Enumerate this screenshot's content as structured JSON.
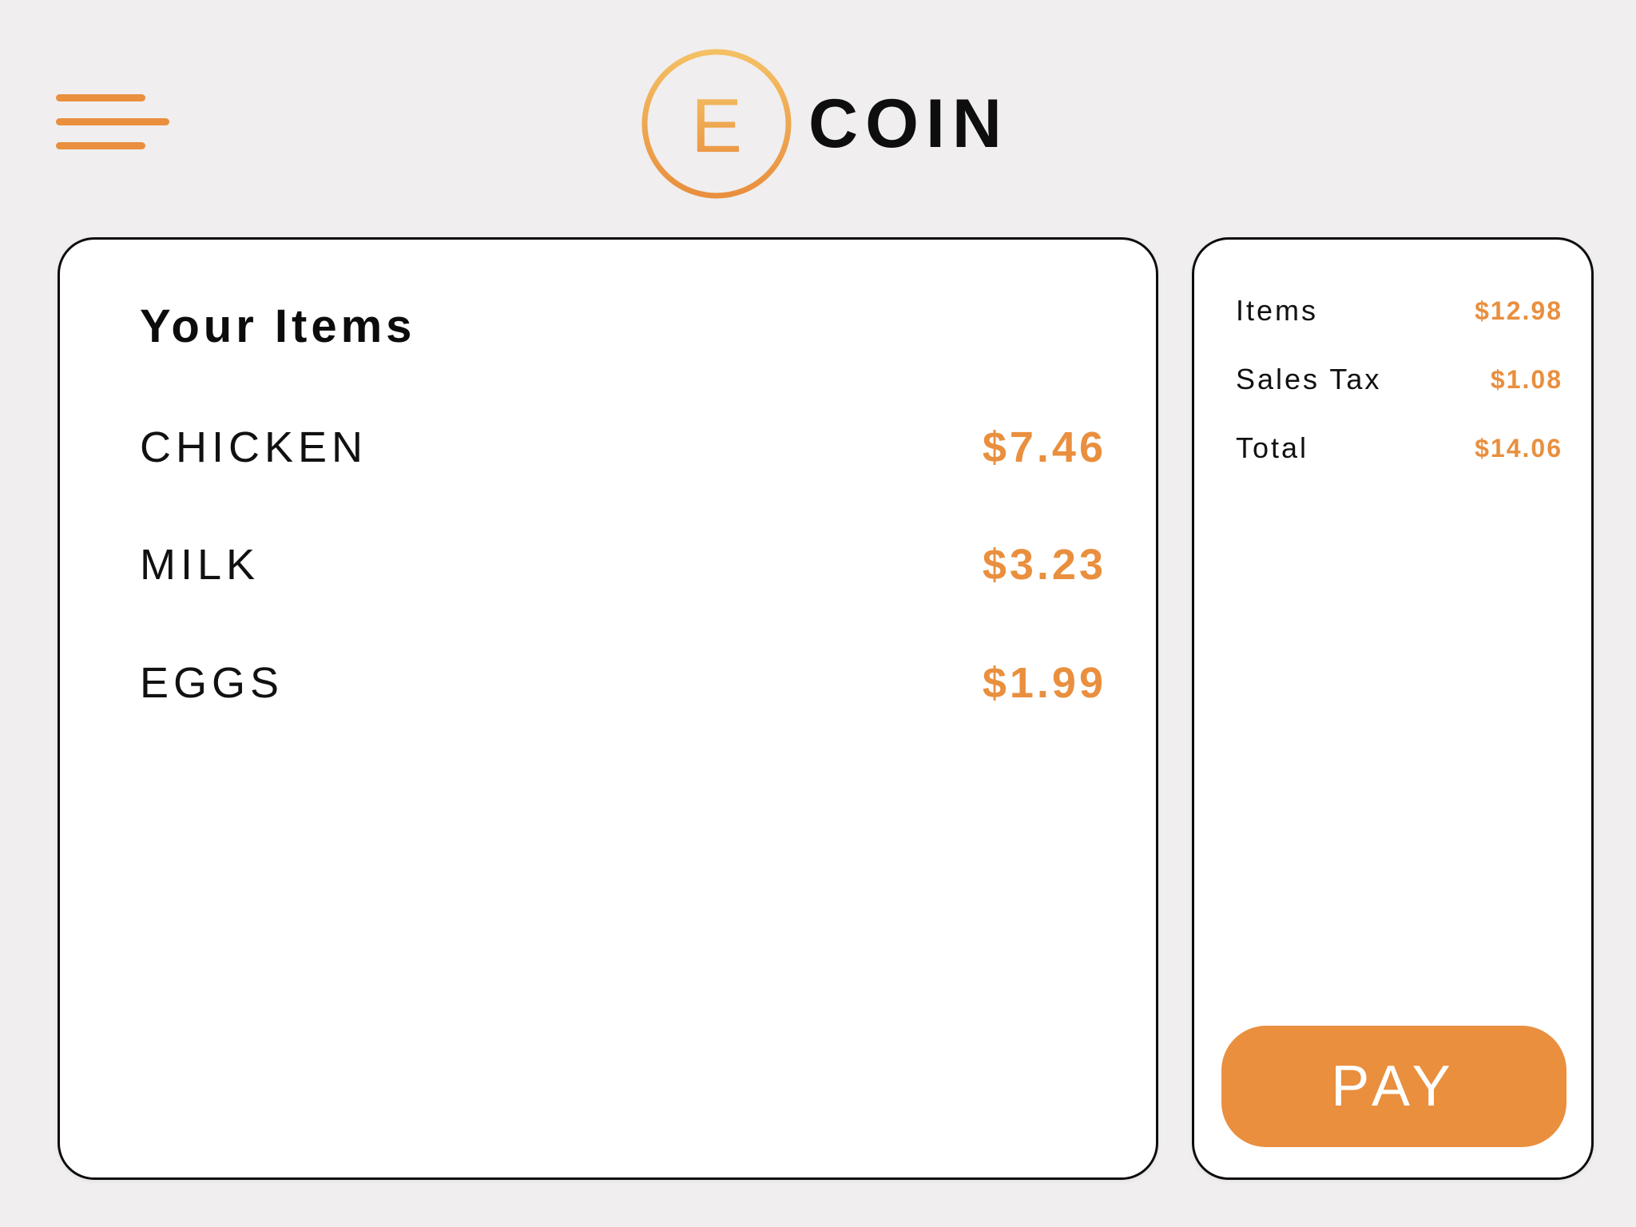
{
  "header": {
    "menu_icon": "hamburger-menu-icon",
    "logo": {
      "mark_letter": "E",
      "text": "COIN",
      "mark_color": "#e98f3e",
      "mark_color_light": "#f4c063"
    }
  },
  "items_panel": {
    "title": "Your Items",
    "items": [
      {
        "name": "CHICKEN",
        "price": "$7.46"
      },
      {
        "name": "MILK",
        "price": "$3.23"
      },
      {
        "name": "EGGS",
        "price": "$1.99"
      }
    ]
  },
  "summary_panel": {
    "rows": [
      {
        "label": "Items",
        "value": "$12.98"
      },
      {
        "label": "Sales Tax",
        "value": "$1.08"
      },
      {
        "label": "Total",
        "value": "$14.06"
      }
    ],
    "pay_label": "PAY"
  },
  "colors": {
    "accent": "#e98f3e",
    "background": "#f0eeef",
    "panel": "#ffffff",
    "border": "#0c0c0c"
  }
}
